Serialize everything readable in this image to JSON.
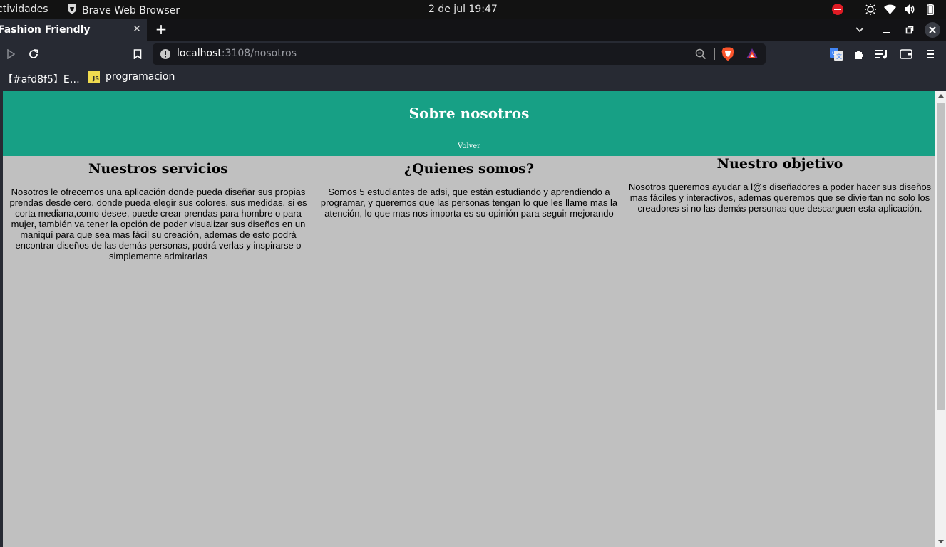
{
  "system_bar": {
    "activities": "ctividades",
    "app_name": "Brave Web Browser",
    "clock": "2 de jul  19:47"
  },
  "browser": {
    "tab_title": "Fashion Friendly",
    "url_host": "localhost",
    "url_path": ":3108/nosotros",
    "bookmarks": [
      "【#afd8f5】E…",
      "programacion"
    ],
    "bookmark_js_badge": "JS"
  },
  "page": {
    "title": "Sobre nosotros",
    "back_link": "Volver",
    "sections": [
      {
        "heading": "Nuestros servicios",
        "body": "Nosotros le ofrecemos una aplicación donde pueda diseñar sus propias prendas desde cero, donde pueda elegir sus colores, sus medidas, si es corta mediana,como desee, puede crear prendas para hombre o para mujer, también va tener la opción de poder visualizar sus diseños en un maniquí para que sea mas fácil su creación, ademas de esto podrá encontrar diseños de las demás personas, podrá verlas y inspirarse o simplemente admirarlas"
      },
      {
        "heading": "¿Quienes somos?",
        "body": "Somos 5 estudiantes de adsi, que están estudiando y aprendiendo a programar, y queremos que las personas tengan lo que les llame mas la atención, lo que mas nos importa es su opinión para seguir mejorando"
      },
      {
        "heading": "Nuestro objetivo",
        "body": "Nosotros queremos ayudar a l@s diseñadores a poder hacer sus diseños mas fáciles y interactivos, ademas queremos que se diviertan no solo los creadores si no las demás personas que descarguen esta aplicación."
      }
    ]
  },
  "colors": {
    "header_bg": "#17a085",
    "page_bg": "#c0c0c0",
    "browser_chrome": "#272a33"
  }
}
